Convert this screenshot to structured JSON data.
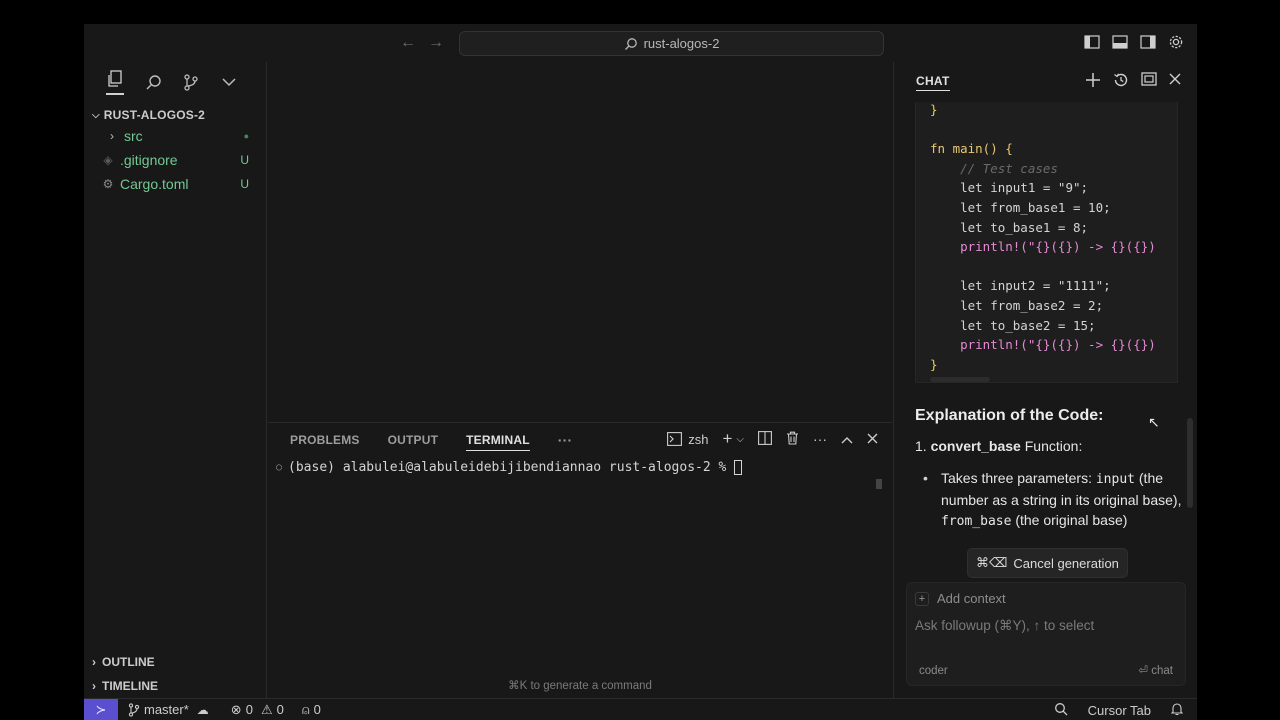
{
  "titlebar": {
    "search_text": "rust-alogos-2"
  },
  "sidebar": {
    "explorer_title": "RUST-ALOGOS-2",
    "files": [
      {
        "name": "src",
        "status": "●",
        "kind": "folder"
      },
      {
        "name": ".gitignore",
        "status": "U",
        "kind": "file"
      },
      {
        "name": "Cargo.toml",
        "status": "U",
        "kind": "file"
      }
    ],
    "outline_label": "OUTLINE",
    "timeline_label": "TIMELINE"
  },
  "panel": {
    "tabs": [
      "PROBLEMS",
      "OUTPUT",
      "TERMINAL"
    ],
    "active_tab": "TERMINAL",
    "shell": "zsh",
    "prompt": "(base) alabulei@alabuleidebijibendiannao rust-alogos-2 % ",
    "hint": "⌘K to generate a command"
  },
  "chat": {
    "title": "CHAT",
    "code_lines": [
      "}",
      "",
      "fn main() {",
      "    // Test cases",
      "    let input1 = \"9\";",
      "    let from_base1 = 10;",
      "    let to_base1 = 8;",
      "    println!(\"{}({}) -> {}({})",
      "",
      "    let input2 = \"1111\";",
      "    let from_base2 = 2;",
      "    let to_base2 = 15;",
      "    println!(\"{}({}) -> {}({})",
      "}"
    ],
    "explanation_heading": "Explanation of the Code:",
    "list_item_1_num": "1.",
    "list_item_1_name": "convert_base",
    "list_item_1_suffix": "Function:",
    "bullet_text_1": "Takes three parameters: ",
    "bullet_code_1": "input",
    "bullet_text_2": "(the number as a string in its",
    "bullet_text_3": "original base),",
    "bullet_code_2": "from_base",
    "bullet_text_4": "(the",
    "bullet_text_5": "original base)",
    "tooltip_shortcut": "⌘⌫",
    "tooltip_label": "Cancel generation",
    "add_context": "Add context",
    "followup_placeholder": "Ask followup (⌘Y), ↑ to select",
    "mode_label": "coder",
    "send_label": "⏎ chat"
  },
  "statusbar": {
    "branch": "master*",
    "errors": "0",
    "warnings": "0",
    "ports": "0",
    "cursor_tab": "Cursor Tab"
  }
}
